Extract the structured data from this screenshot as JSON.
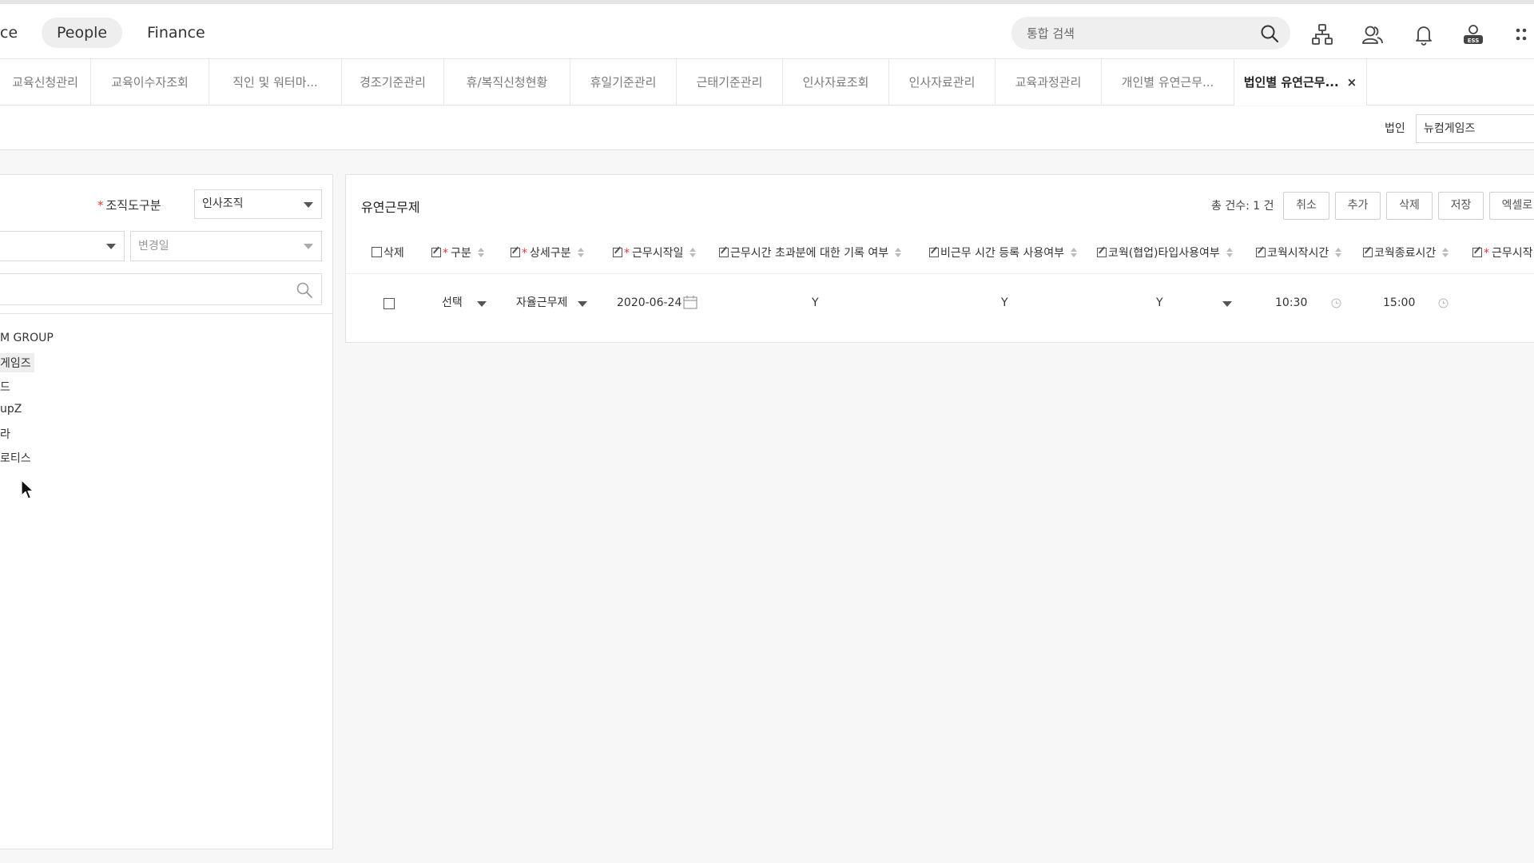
{
  "header": {
    "nav": [
      {
        "label": "ce",
        "active": false
      },
      {
        "label": "People",
        "active": true
      },
      {
        "label": "Finance",
        "active": false
      }
    ],
    "search_placeholder": "통합 검색",
    "icons": [
      "org-chart-icon",
      "people-icon",
      "bell-icon",
      "ess-user-icon",
      "apps-grid-icon"
    ]
  },
  "tabs": [
    {
      "label": "교육신청관리"
    },
    {
      "label": "교육이수자조회"
    },
    {
      "label": "직인 및 워터마..."
    },
    {
      "label": "경조기준관리"
    },
    {
      "label": "휴/복직신청현황"
    },
    {
      "label": "휴일기준관리"
    },
    {
      "label": "근태기준관리"
    },
    {
      "label": "인사자료조회"
    },
    {
      "label": "인사자료관리"
    },
    {
      "label": "교육과정관리"
    },
    {
      "label": "개인별 유연근무..."
    },
    {
      "label": "법인별 유연근무...",
      "active": true,
      "close": "×"
    }
  ],
  "filter": {
    "corp_label": "법인",
    "corp_value": "뉴컴게임즈"
  },
  "left_panel": {
    "org_label": "조직도구분",
    "org_required": "*",
    "org_value": "인사조직",
    "change_date_placeholder": "변경일",
    "tree": [
      "M GROUP",
      "게임즈",
      "드",
      "upZ",
      "라",
      "로티스"
    ]
  },
  "grid": {
    "title": "유연근무제",
    "total": "총 건수: 1 건",
    "buttons": {
      "cancel": "취소",
      "add": "추가",
      "delete": "삭제",
      "save": "저장",
      "excel": "엑셀로"
    },
    "columns": {
      "delete": "삭제",
      "type": "구분",
      "detail_type": "상세구분",
      "start_date": "근무시작일",
      "overtime_record": "근무시간 초과분에 대한 기록 여부",
      "non_work_register": "비근무 시간 등록 사용여부",
      "cowork_type": "코웍(협업)타입사용여부",
      "cowork_start": "코웍시작시간",
      "cowork_end": "코웍종료시간",
      "work_start": "근무시작"
    },
    "rows": [
      {
        "type": "선택",
        "detail_type": "자율근무제",
        "start_date": "2020-06-24",
        "overtime_record": "Y",
        "non_work_register": "Y",
        "cowork_type": "Y",
        "cowork_start": "10:30",
        "cowork_end": "15:00"
      }
    ]
  }
}
